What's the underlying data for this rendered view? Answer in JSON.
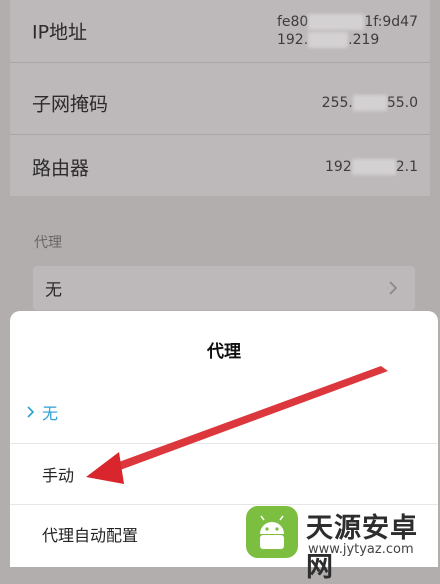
{
  "network_info": {
    "rows": [
      {
        "label": "IP地址",
        "value_line1_start": "fe80",
        "value_line1_end": "1f:9d47",
        "value_line2_start": "192.",
        "value_line2_end": ".219"
      },
      {
        "label": "子网掩码",
        "value_start": "255.",
        "value_end": "55.0"
      },
      {
        "label": "路由器",
        "value_start": "192",
        "value_end": "2.1"
      }
    ]
  },
  "proxy_section": {
    "label": "代理",
    "current_value": "无",
    "chevron_icon": "chevron-right-icon"
  },
  "proxy_sheet": {
    "title": "代理",
    "options": [
      {
        "label": "无",
        "selected": true
      },
      {
        "label": "手动",
        "selected": false
      },
      {
        "label": "代理自动配置",
        "selected": false
      }
    ],
    "accent_color": "#2c9fd8"
  },
  "annotation": {
    "arrow_color": "#d9262c",
    "icon": "red-arrow-icon"
  },
  "watermark": {
    "title": "天源安卓网",
    "url": "www.jytyaz.com"
  }
}
